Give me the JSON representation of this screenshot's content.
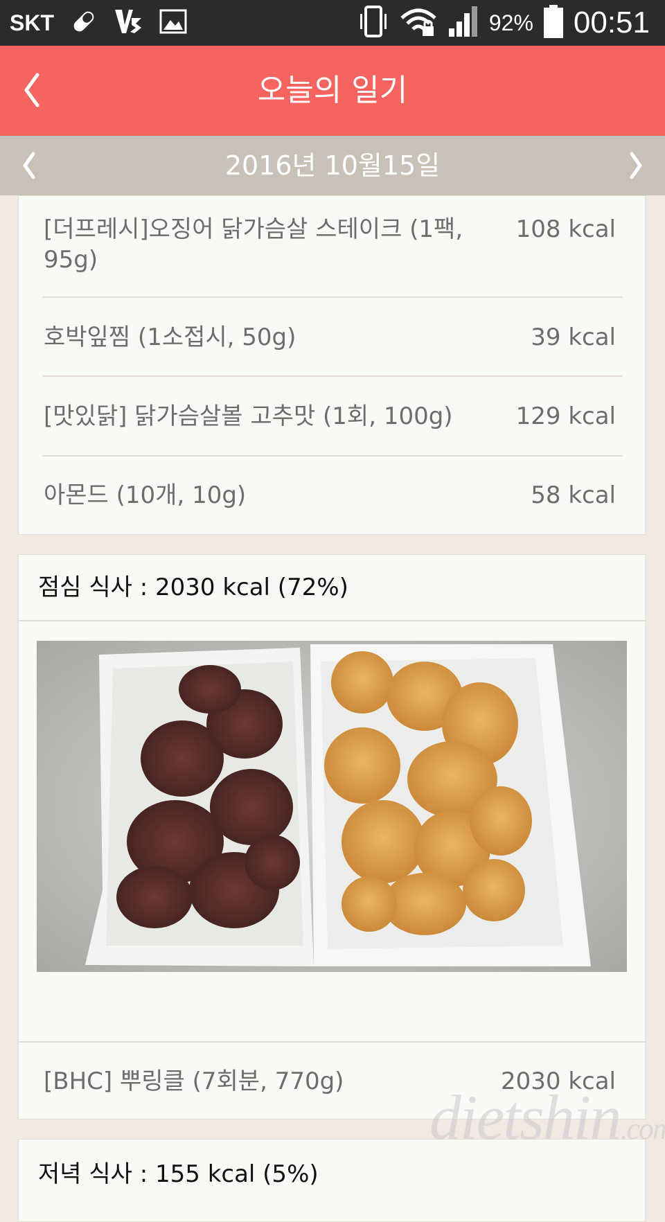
{
  "status_bar": {
    "carrier": "SKT",
    "battery_percent": "92%",
    "time": "00:51",
    "icons": [
      "pill-icon",
      "v3-app-icon",
      "gallery-icon",
      "vibrate-icon",
      "wifi-lock-icon",
      "signal-icon",
      "battery-icon"
    ]
  },
  "header": {
    "title": "오늘의 일기",
    "back_icon": "chevron-left-icon",
    "color": "#f5645e"
  },
  "date_nav": {
    "date": "2016년 10월15일",
    "prev_icon": "chevron-left-icon",
    "next_icon": "chevron-right-icon",
    "color": "#c9c1b8"
  },
  "breakfast_items": [
    {
      "name": "[더프레시]오징어 닭가슴살 스테이크 (1팩, 95g)",
      "kcal": "108 kcal"
    },
    {
      "name": "호박잎찜 (1소접시, 50g)",
      "kcal": "39 kcal"
    },
    {
      "name": "[맛있닭] 닭가슴살볼 고추맛 (1회, 100g)",
      "kcal": "129 kcal"
    },
    {
      "name": "아몬드 (10개, 10g)",
      "kcal": "58 kcal"
    }
  ],
  "lunch": {
    "title": "점심 식사 : 2030 kcal (72%)",
    "items": [
      {
        "name": "[BHC] 뿌링클 (7회분, 770g)",
        "kcal": "2030 kcal"
      }
    ]
  },
  "dinner": {
    "title": "저녁 식사 : 155 kcal (5%)"
  },
  "watermark": {
    "text": "dietshin",
    "suffix": ".com"
  }
}
